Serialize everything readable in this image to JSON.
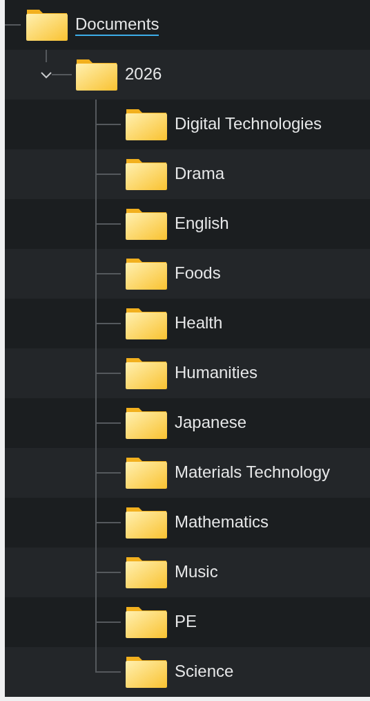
{
  "tree": {
    "name": "Documents",
    "hovered": true,
    "children": [
      {
        "name": "2026",
        "expanded": true,
        "children": [
          {
            "name": "Digital Technologies"
          },
          {
            "name": "Drama"
          },
          {
            "name": "English"
          },
          {
            "name": "Foods"
          },
          {
            "name": "Health"
          },
          {
            "name": "Humanities"
          },
          {
            "name": "Japanese"
          },
          {
            "name": "Materials Technology"
          },
          {
            "name": "Mathematics"
          },
          {
            "name": "Music"
          },
          {
            "name": "PE"
          },
          {
            "name": "Science"
          }
        ]
      }
    ]
  }
}
